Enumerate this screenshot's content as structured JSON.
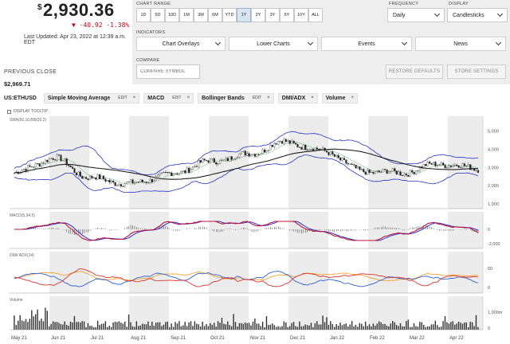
{
  "price": {
    "currency_symbol": "$",
    "value": "2,930.36",
    "change": "▼ -40.92 -1.38%",
    "updated": "Last Updated: Apr 23, 2022 at 12:39 a.m. EDT",
    "previous_close_label": "PREVIOUS CLOSE",
    "previous_close_value": "$2,969.71"
  },
  "controls": {
    "chart_range_label": "CHART RANGE",
    "ranges": [
      "1D",
      "5D",
      "10D",
      "1M",
      "3M",
      "6M",
      "YTD",
      "1Y",
      "2Y",
      "3Y",
      "5Y",
      "10Y",
      "ALL"
    ],
    "active_range": "1Y",
    "frequency_label": "FREQUENCY",
    "frequency_value": "Daily",
    "display_label": "DISPLAY",
    "display_value": "Candlesticks",
    "indicators_label": "INDICATORS",
    "chart_overlays": "Chart Overlays",
    "lower_charts": "Lower Charts",
    "events": "Events",
    "news": "News",
    "compare_label": "COMPARE",
    "compare_placeholder": "COMPARE SYMBOL",
    "restore_defaults": "RESTORE DEFAULTS",
    "store_settings": "STORE SETTINGS"
  },
  "studies": {
    "symbol": "US:ETHUSD",
    "edit_label": "EDIT",
    "close_label": "×",
    "sma": "Simple Moving Average",
    "macd": "MACD",
    "bollinger": "Bollinger Bands",
    "dmi": "DMI/ADX",
    "volume": "Volume"
  },
  "chart": {
    "tooltip_label": "DISPLAY TOOLTIP",
    "panes": {
      "price": {
        "label": "SMA(50,10,BB(20,2)",
        "ticks": [
          "5,000",
          "4,000",
          "3,000",
          "2,000",
          "1,000"
        ]
      },
      "macd": {
        "label": "MACD(5,34,5)",
        "ticks": [
          "0",
          "-2,000"
        ]
      },
      "dmi": {
        "label": "DMI/ ADX(14)",
        "ticks": [
          "50",
          "0"
        ]
      },
      "volume": {
        "label": "Volume",
        "ticks": [
          "1,000m",
          "0"
        ]
      }
    },
    "months": [
      "May 21",
      "Jun 21",
      "Jul 21",
      "Aug 21",
      "Sep 21",
      "Oct 21",
      "Nov 21",
      "Dec 21",
      "Jan 22",
      "Feb 22",
      "Mar 22",
      "Apr 22"
    ],
    "colors": {
      "bollinger": "#2433c8",
      "sma_fast": "#3cb54a",
      "sma_slow": "#222222",
      "macd_line": "#c0143c",
      "macd_signal": "#2433c8",
      "dmi_plus": "#2f5fd6",
      "dmi_minus": "#e0342c",
      "adx": "#f5a030",
      "shade": "#ececec"
    }
  },
  "chart_data": {
    "type": "line",
    "title": "",
    "x": [
      "May 21",
      "Jun 21",
      "Jul 21",
      "Aug 21",
      "Sep 21",
      "Oct 21",
      "Nov 21",
      "Dec 21",
      "Jan 22",
      "Feb 22",
      "Mar 22",
      "Apr 22"
    ],
    "series": [
      {
        "name": "",
        "values": [
          2700,
          3500,
          2400,
          2100,
          2600,
          3300,
          3700,
          4400,
          3900,
          2800,
          2700,
          3200,
          2950
        ]
      }
    ],
    "ylim": [
      1000,
      5200
    ]
  }
}
